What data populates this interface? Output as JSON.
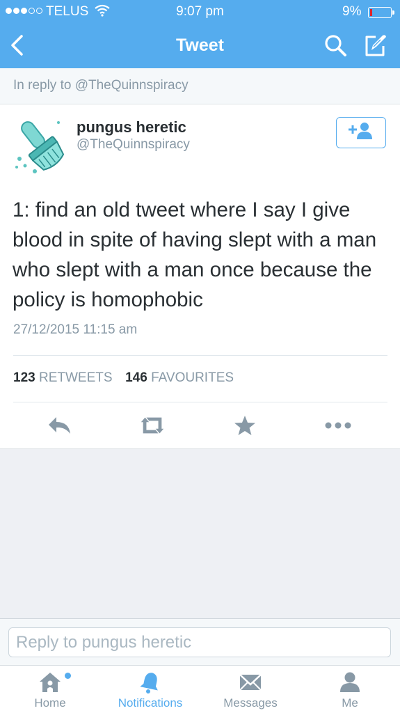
{
  "status_bar": {
    "carrier": "TELUS",
    "time": "9:07 pm",
    "battery_percent": "9%"
  },
  "nav": {
    "title": "Tweet",
    "icons": [
      "back-chevron-icon",
      "search-icon",
      "compose-icon"
    ]
  },
  "reply_context": {
    "text": "In reply to @TheQuinnspiracy"
  },
  "tweet": {
    "display_name": "pungus heretic",
    "handle": "@TheQuinnspiracy",
    "text": "1: find an old tweet where I say I give blood in spite of having slept with a man who slept with a man once because the policy is homophobic",
    "timestamp": "27/12/2015 11:15 am",
    "retweets_count": "123",
    "retweets_label": "RETWEETS",
    "favourites_count": "146",
    "favourites_label": "FAVOURITES",
    "actions": [
      "reply-icon",
      "retweet-icon",
      "favourite-star-icon",
      "more-icon"
    ]
  },
  "reply_bar": {
    "placeholder": "Reply to pungus heretic"
  },
  "tab_bar": {
    "tabs": [
      {
        "label": "Home",
        "icon": "home-icon",
        "active": false
      },
      {
        "label": "Notifications",
        "icon": "bell-icon",
        "active": true
      },
      {
        "label": "Messages",
        "icon": "envelope-icon",
        "active": false
      },
      {
        "label": "Me",
        "icon": "person-icon",
        "active": false
      }
    ]
  },
  "colors": {
    "brand_blue": "#55acee",
    "text_dark": "#292f33",
    "text_gray": "#8899a6",
    "icon_gray": "#8899a6",
    "battery_low": "#e0242b"
  }
}
